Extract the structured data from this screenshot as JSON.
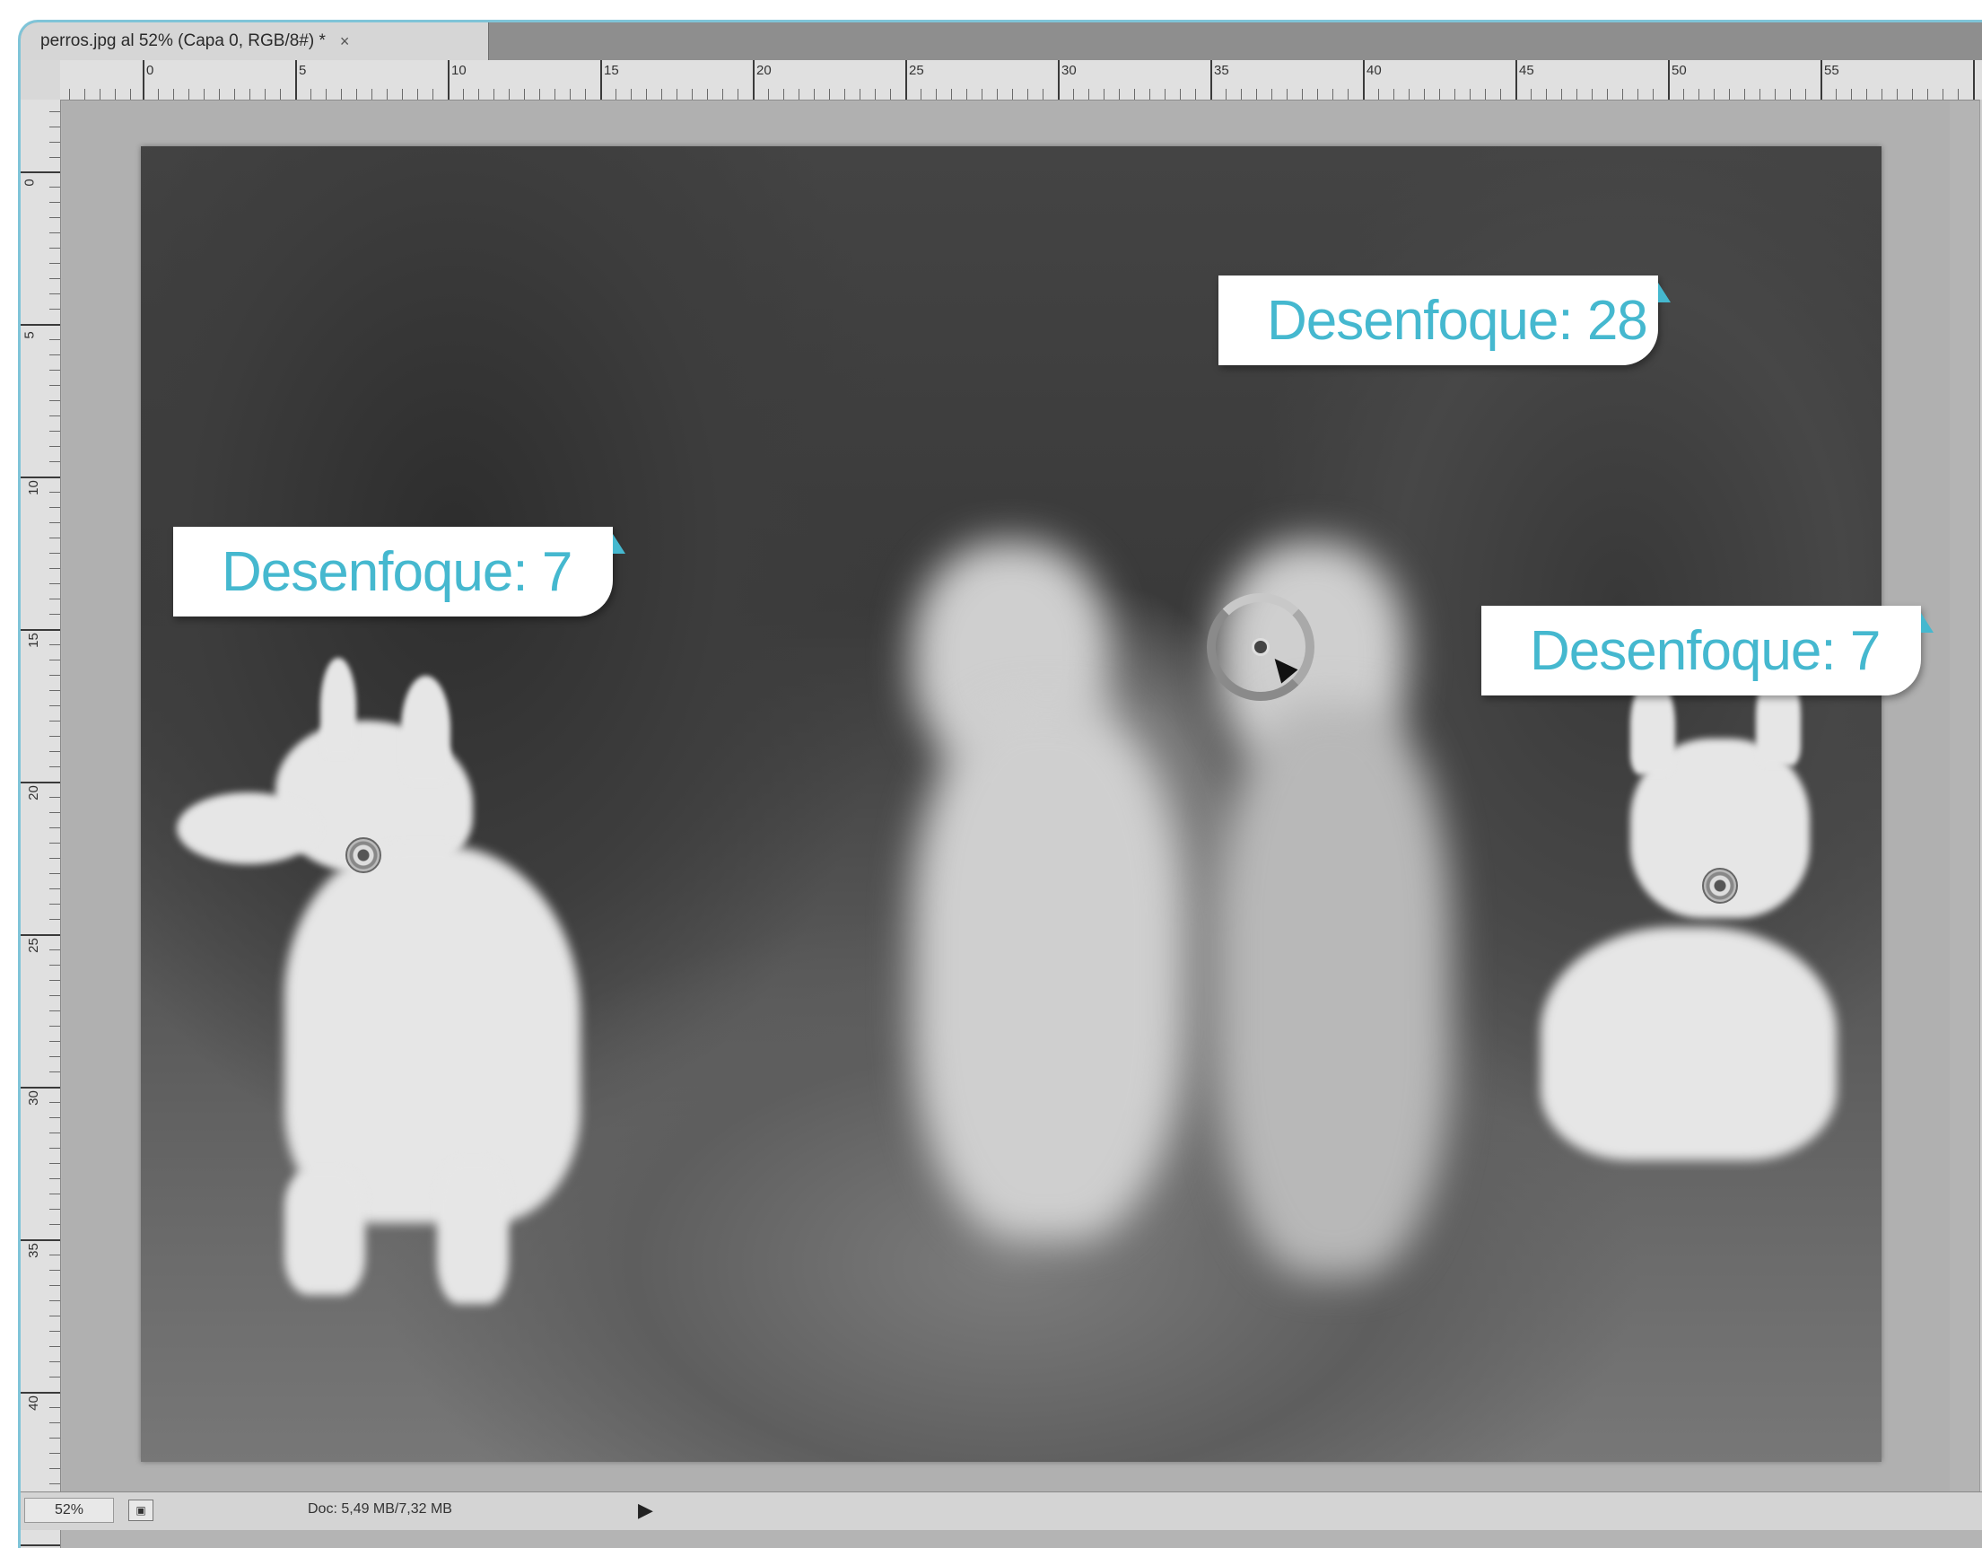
{
  "window": {
    "tab_title": "perros.jpg al 52% (Capa 0, RGB/8#) *",
    "tab_close": "×"
  },
  "ruler": {
    "horizontal_labels": [
      "0",
      "5",
      "10",
      "15",
      "20",
      "25",
      "30",
      "35",
      "40",
      "45",
      "50",
      "55"
    ],
    "vertical_labels": [
      "0",
      "5",
      "10",
      "15",
      "20",
      "25",
      "30",
      "35",
      "40"
    ]
  },
  "callouts": [
    {
      "label": "Desenfoque: 7"
    },
    {
      "label": "Desenfoque: 28"
    },
    {
      "label": "Desenfoque: 7"
    }
  ],
  "status": {
    "zoom": "52%",
    "doc_info": "Doc: 5,49 MB/7,32 MB",
    "arrow": "▶"
  },
  "colors": {
    "window_border": "#7fc4d8",
    "callout_text": "#45b8cf"
  }
}
